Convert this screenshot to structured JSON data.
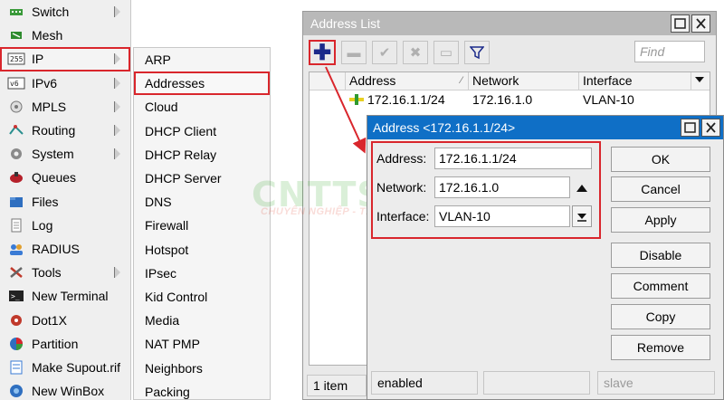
{
  "main_menu": {
    "items": [
      {
        "label": "Switch",
        "icon": "switch-icon",
        "arrow": true
      },
      {
        "label": "Mesh",
        "icon": "mesh-icon",
        "arrow": false
      },
      {
        "label": "IP",
        "icon": "ip-icon",
        "arrow": true
      },
      {
        "label": "IPv6",
        "icon": "ipv6-icon",
        "arrow": true
      },
      {
        "label": "MPLS",
        "icon": "mpls-icon",
        "arrow": true
      },
      {
        "label": "Routing",
        "icon": "routing-icon",
        "arrow": true
      },
      {
        "label": "System",
        "icon": "gear-icon",
        "arrow": true
      },
      {
        "label": "Queues",
        "icon": "queues-icon",
        "arrow": false
      },
      {
        "label": "Files",
        "icon": "folder-icon",
        "arrow": false
      },
      {
        "label": "Log",
        "icon": "log-icon",
        "arrow": false
      },
      {
        "label": "RADIUS",
        "icon": "users-icon",
        "arrow": false
      },
      {
        "label": "Tools",
        "icon": "tools-icon",
        "arrow": true
      },
      {
        "label": "New Terminal",
        "icon": "terminal-icon",
        "arrow": false
      },
      {
        "label": "Dot1X",
        "icon": "dot1x-icon",
        "arrow": false
      },
      {
        "label": "Partition",
        "icon": "pie-icon",
        "arrow": false
      },
      {
        "label": "Make Supout.rif",
        "icon": "supout-icon",
        "arrow": false
      },
      {
        "label": "New WinBox",
        "icon": "winbox-icon",
        "arrow": false
      }
    ]
  },
  "ip_submenu": {
    "items": [
      "ARP",
      "Addresses",
      "Cloud",
      "DHCP Client",
      "DHCP Relay",
      "DHCP Server",
      "DNS",
      "Firewall",
      "Hotspot",
      "IPsec",
      "Kid Control",
      "Media",
      "NAT PMP",
      "Neighbors",
      "Packing"
    ]
  },
  "address_list": {
    "title": "Address List",
    "find_placeholder": "Find",
    "columns": [
      "Address",
      "Network",
      "Interface"
    ],
    "rows": [
      {
        "address": "172.16.1.1/24",
        "network": "172.16.1.0",
        "interface": "VLAN-10"
      }
    ],
    "status_count": "1 item"
  },
  "address_dialog": {
    "title": "Address <172.16.1.1/24>",
    "address_label": "Address:",
    "address_value": "172.16.1.1/24",
    "network_label": "Network:",
    "network_value": "172.16.1.0",
    "interface_label": "Interface:",
    "interface_value": "VLAN-10",
    "buttons": {
      "ok": "OK",
      "cancel": "Cancel",
      "apply": "Apply",
      "disable": "Disable",
      "comment": "Comment",
      "copy": "Copy",
      "remove": "Remove"
    },
    "status_enabled": "enabled",
    "status_slave": "slave"
  },
  "watermark": {
    "brand": "CNTTSHOP.VN",
    "tagline": "CHUYÊN NGHIỆP - TẬN TÂM"
  },
  "colors": {
    "highlight_red": "#d9262c",
    "dialog_title_blue": "#0f6fc6",
    "window_title_gray": "#b9b9b9"
  }
}
